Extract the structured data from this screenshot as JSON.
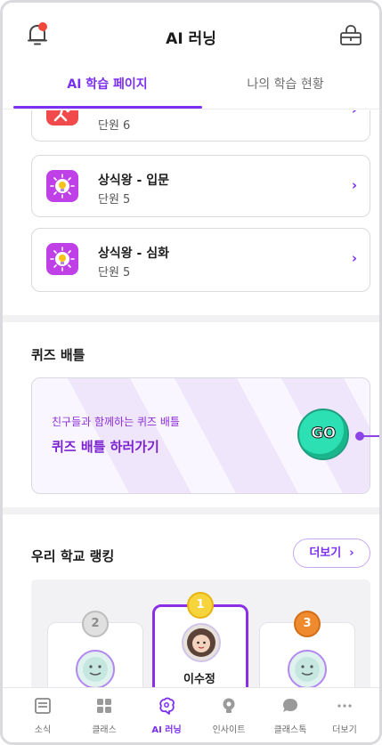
{
  "header": {
    "title": "AI 러닝",
    "bell_icon": "bell-icon",
    "shop_icon": "shopping-basket-icon"
  },
  "tabs": [
    {
      "label": "AI 학습 페이지",
      "active": true
    },
    {
      "label": "나의 학습 현황",
      "active": false
    }
  ],
  "courses": [
    {
      "name": "",
      "unit": "단원 6",
      "icon": "sports-person-icon",
      "icon_color": "#f04a4a"
    },
    {
      "name": "상식왕 - 입문",
      "unit": "단원 5",
      "icon": "lightbulb-icon",
      "icon_color": "#c040e8"
    },
    {
      "name": "상식왕 - 심화",
      "unit": "단원 5",
      "icon": "lightbulb-icon",
      "icon_color": "#c040e8"
    }
  ],
  "quiz": {
    "section_title": "퀴즈 배틀",
    "subtitle": "친구들과 함께하는 퀴즈 배틀",
    "main_text": "퀴즈 배틀 하러가기",
    "go_label": "GO"
  },
  "ranking": {
    "section_title": "우리 학교 랭킹",
    "more_label": "더보기",
    "entries": [
      {
        "rank": "2",
        "name": ""
      },
      {
        "rank": "1",
        "name": "이수정"
      },
      {
        "rank": "3",
        "name": ""
      }
    ]
  },
  "bottom_nav": [
    {
      "label": "소식",
      "icon": "news-icon",
      "active": false
    },
    {
      "label": "클래스",
      "icon": "grid-icon",
      "active": false
    },
    {
      "label": "AI 러닝",
      "icon": "ai-brain-icon",
      "active": true
    },
    {
      "label": "인사이트",
      "icon": "lightbulb-icon",
      "active": false
    },
    {
      "label": "클래스톡",
      "icon": "chat-bubble-icon",
      "active": false
    },
    {
      "label": "더보기",
      "icon": "more-dots-icon",
      "active": false
    }
  ],
  "colors": {
    "accent": "#7b2ff0",
    "go_button": "#2ce0b4",
    "notification": "#f0473c"
  }
}
